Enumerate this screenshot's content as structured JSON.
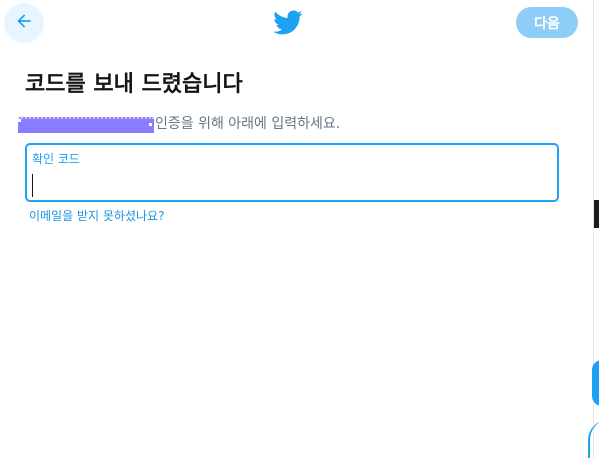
{
  "header": {
    "back_icon": "arrow-left-icon",
    "logo_icon": "twitter-bird-icon",
    "next_label": "다음"
  },
  "main": {
    "title": "코드를 보내 드렸습니다",
    "description": "인증을 위해 아래에 입력하세요.",
    "code_field": {
      "label": "확인 코드",
      "value": ""
    },
    "help_link": "이메일을 받지 못하셨나요?"
  },
  "colors": {
    "accent": "#1da1f2",
    "accent_light": "#8ecdf8",
    "back_bg": "#e8f5fe",
    "title": "#14171a",
    "secondary_text": "#657786",
    "redaction": "#8a7cff"
  }
}
